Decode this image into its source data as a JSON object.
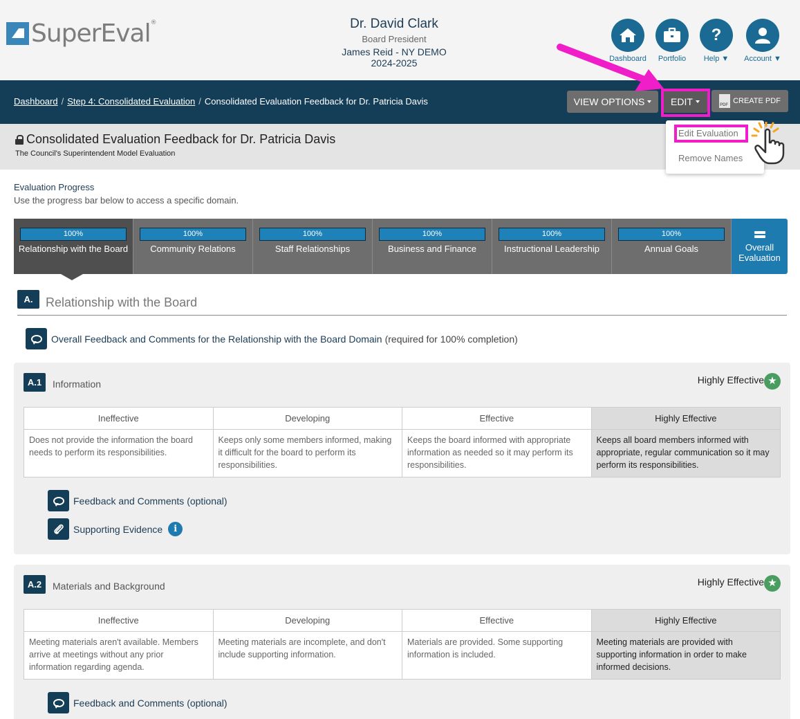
{
  "app": {
    "logo_text": "SuperEval",
    "logo_mark": "®"
  },
  "user": {
    "name": "Dr. David Clark",
    "role": "Board President",
    "district": "James Reid - NY DEMO",
    "year": "2024-2025"
  },
  "nav": [
    {
      "label": "Dashboard",
      "icon": "home-icon"
    },
    {
      "label": "Portfolio",
      "icon": "briefcase-icon"
    },
    {
      "label": "Help",
      "icon": "question-icon"
    },
    {
      "label": "Account",
      "icon": "user-icon"
    }
  ],
  "breadcrumb": {
    "items": [
      "Dashboard",
      "Step 4: Consolidated Evaluation"
    ],
    "current": "Consolidated Evaluation Feedback for Dr. Patricia Davis",
    "separator": "/"
  },
  "toolbar": {
    "view_options": "VIEW OPTIONS",
    "edit": "EDIT",
    "create_pdf": "CREATE PDF",
    "pdf_icon_text": "PDF"
  },
  "edit_menu": {
    "items": [
      "Edit Evaluation",
      "Remove Names"
    ]
  },
  "page": {
    "title": "Consolidated Evaluation Feedback for Dr. Patricia Davis",
    "subtitle": "The Council's Superintendent Model Evaluation"
  },
  "progress": {
    "heading": "Evaluation Progress",
    "description": "Use the progress bar below to access a specific domain.",
    "domains": [
      {
        "label": "Relationship with the Board",
        "percent": "100%",
        "progress": 1.0,
        "active": true
      },
      {
        "label": "Community Relations",
        "percent": "100%",
        "progress": 1.0
      },
      {
        "label": "Staff Relationships",
        "percent": "100%",
        "progress": 1.0
      },
      {
        "label": "Business and Finance",
        "percent": "100%",
        "progress": 1.0
      },
      {
        "label": "Instructional Leadership",
        "percent": "100%",
        "progress": 1.0
      },
      {
        "label": "Annual Goals",
        "percent": "100%",
        "progress": 1.0
      }
    ],
    "overall_label": "Overall Evaluation"
  },
  "domain": {
    "badge": "A.",
    "title": "Relationship with the Board",
    "overall_feedback_link": "Overall Feedback and Comments for the Relationship with the Board Domain",
    "overall_feedback_note": "(required for 100% completion)"
  },
  "rubric_headers": [
    "Ineffective",
    "Developing",
    "Effective",
    "Highly Effective"
  ],
  "competencies": [
    {
      "badge": "A.1",
      "title": "Information",
      "rating": "Highly Effective",
      "selected_index": 3,
      "descriptors": [
        "Does not provide the information the board needs to perform its responsibilities.",
        "Keeps only some members informed, making it difficult for the board to perform its responsibilities.",
        "Keeps the board informed with appropriate information as needed so it may perform its responsibilities.",
        "Keeps all board members informed with appropriate, regular communication so it may perform its responsibilities."
      ],
      "feedback_link": "Feedback and Comments (optional)",
      "evidence_link": "Supporting Evidence"
    },
    {
      "badge": "A.2",
      "title": "Materials and Background",
      "rating": "Highly Effective",
      "selected_index": 3,
      "descriptors": [
        "Meeting materials aren't available. Members arrive at meetings without any prior information regarding agenda.",
        "Meeting materials are incomplete, and don't include supporting information.",
        "Materials are provided. Some supporting information is included.",
        "Meeting materials are provided with supporting information in order to make informed decisions."
      ],
      "feedback_link": "Feedback and Comments (optional)"
    }
  ],
  "colors": {
    "navy": "#143e57",
    "accent_blue": "#1e7bb0",
    "highlight_magenta": "#f01ec8",
    "rating_green": "#4a9d61"
  }
}
